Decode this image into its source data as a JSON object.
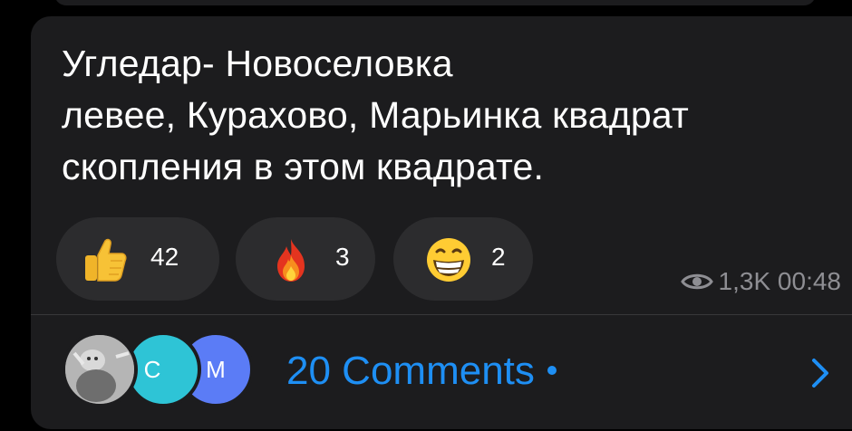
{
  "message": {
    "lines": [
      "Угледар-  Новоселовка",
      "левее, Курахово, Марьинка квадрат",
      "скопления в этом квадрате."
    ]
  },
  "reactions": [
    {
      "emoji": "thumbs-up-icon",
      "count": "42"
    },
    {
      "emoji": "fire-icon",
      "count": "3"
    },
    {
      "emoji": "grinning-face-icon",
      "count": "2"
    }
  ],
  "meta": {
    "views": "1,3K",
    "time": "00:48"
  },
  "comments": {
    "label": "20 Comments",
    "avatars": [
      {
        "initial": "",
        "color": "#8a8a8a"
      },
      {
        "initial": "C",
        "color": "#2ec4d6"
      },
      {
        "initial": "M",
        "color": "#5b7cf6"
      }
    ]
  },
  "colors": {
    "background": "#000000",
    "bubble": "#1c1c1e",
    "reaction_bg": "#2c2c2e",
    "link": "#1e8ff4",
    "meta_text": "#8e8e93"
  }
}
